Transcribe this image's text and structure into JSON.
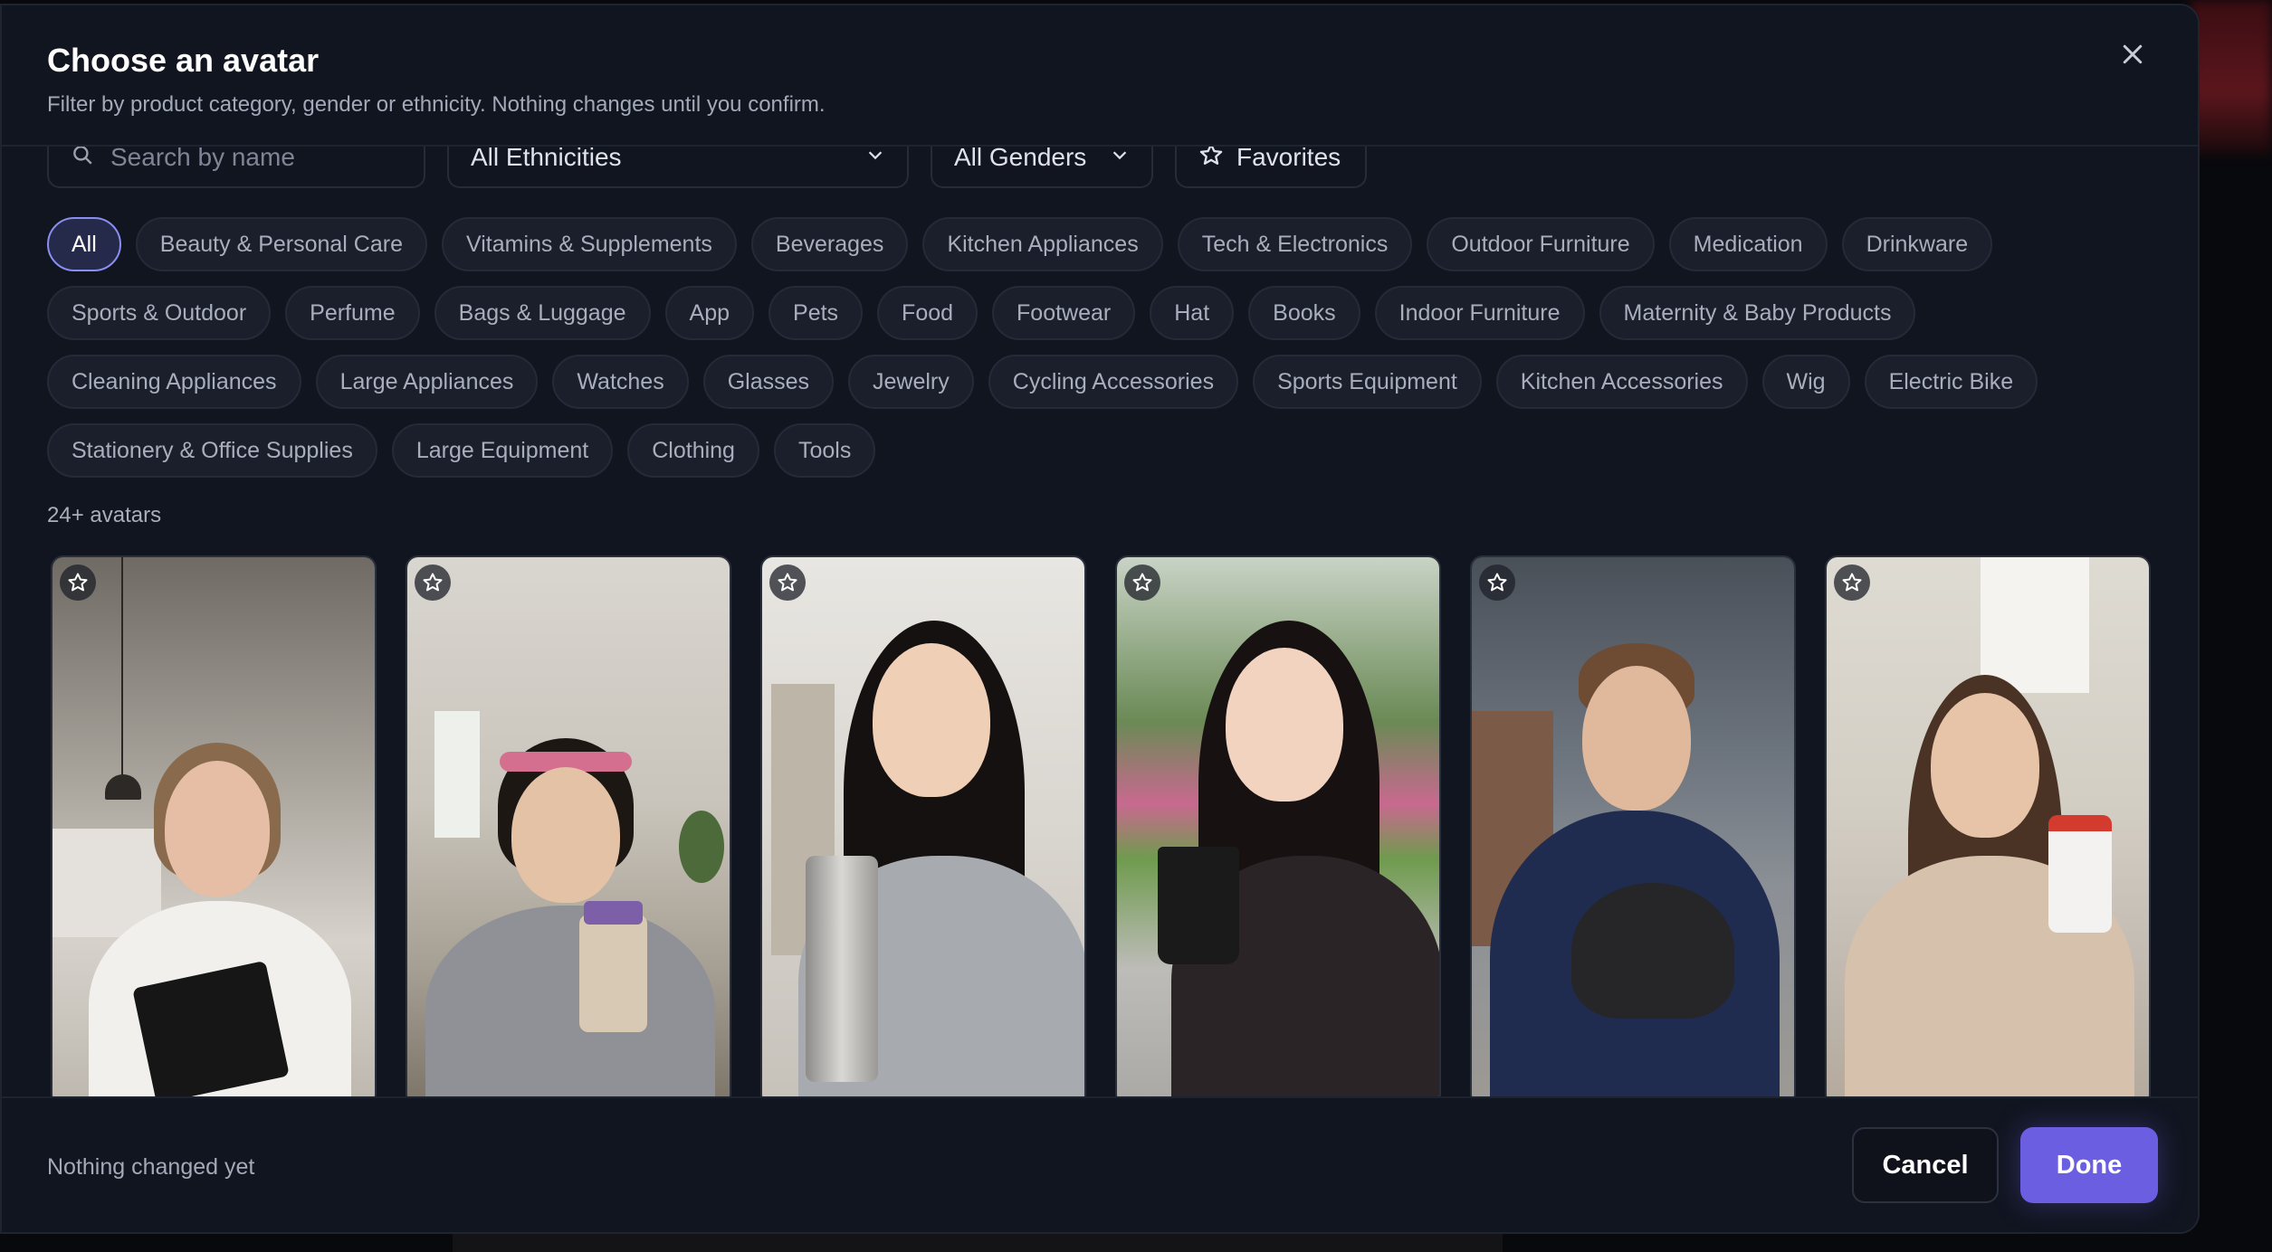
{
  "dialog": {
    "title": "Choose an avatar",
    "subtitle": "Filter by product category, gender or ethnicity. Nothing changes until you confirm."
  },
  "filters": {
    "search_placeholder": "Search by name",
    "ethnicity": "All Ethnicities",
    "gender": "All Genders",
    "favorites": "Favorites"
  },
  "categories": [
    [
      "All",
      "Beauty & Personal Care",
      "Vitamins & Supplements",
      "Beverages",
      "Kitchen Appliances",
      "Tech & Electronics",
      "Outdoor Furniture",
      "Medication",
      "Drinkware"
    ],
    [
      "Sports & Outdoor",
      "Perfume",
      "Bags & Luggage",
      "App",
      "Pets",
      "Food",
      "Footwear",
      "Hat",
      "Books",
      "Indoor Furniture",
      "Maternity & Baby Products"
    ],
    [
      "Cleaning Appliances",
      "Large Appliances",
      "Watches",
      "Glasses",
      "Jewelry",
      "Cycling Accessories",
      "Sports Equipment",
      "Kitchen Accessories",
      "Wig",
      "Electric Bike"
    ],
    [
      "Stationery & Office Supplies",
      "Large Equipment",
      "Clothing",
      "Tools"
    ]
  ],
  "selected_category": "All",
  "avatar_count": "24+ avatars",
  "avatars": [
    {
      "scene": "kitchen",
      "holding": "black wallet"
    },
    {
      "scene": "living room",
      "holding": "supplement bottle"
    },
    {
      "scene": "bedroom",
      "holding": "steel tumbler"
    },
    {
      "scene": "park",
      "holding": "coffee cup"
    },
    {
      "scene": "patio",
      "holding": "bike helmet"
    },
    {
      "scene": "bedroom",
      "holding": "supplement bottle"
    }
  ],
  "footer": {
    "status": "Nothing changed yet",
    "cancel": "Cancel",
    "done": "Done"
  },
  "colors": {
    "accent": "#6b5ee0",
    "background": "#111520",
    "chip_active_border": "#8a8ef0"
  },
  "icons": {
    "close": "close-icon",
    "search": "search-icon",
    "chevron": "chevron-down-icon",
    "star": "star-icon"
  }
}
